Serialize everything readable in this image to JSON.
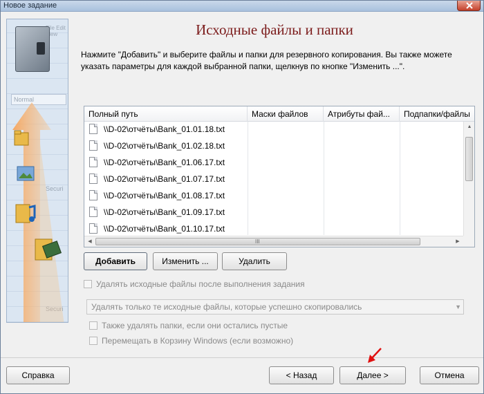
{
  "window": {
    "title": "Новое задание"
  },
  "sidebar": {
    "ghost_menu": "File Edit View",
    "ghost_normal": "Normal",
    "ghost_secur1": "Securi",
    "ghost_secur2": "Securi"
  },
  "page": {
    "heading": "Исходные файлы и папки",
    "description": "Нажмите \"Добавить\" и выберите файлы и папки для резервного копирования. Вы также можете указать параметры для каждой выбранной папки, щелкнув по кнопке \"Изменить ...\"."
  },
  "table": {
    "columns": [
      "Полный путь",
      "Маски файлов",
      "Атрибуты фай...",
      "Подпапки/файлы"
    ],
    "rows": [
      "\\\\D-02\\отчёты\\Bank_01.01.18.txt",
      "\\\\D-02\\отчёты\\Bank_01.02.18.txt",
      "\\\\D-02\\отчёты\\Bank_01.06.17.txt",
      "\\\\D-02\\отчёты\\Bank_01.07.17.txt",
      "\\\\D-02\\отчёты\\Bank_01.08.17.txt",
      "\\\\D-02\\отчёты\\Bank_01.09.17.txt",
      "\\\\D-02\\отчёты\\Bank_01.10.17.txt"
    ],
    "scroll_grip": "III"
  },
  "buttons": {
    "add": "Добавить",
    "edit": "Изменить ...",
    "delete": "Удалить",
    "help": "Справка",
    "back": "< Назад",
    "next": "Далее >",
    "cancel": "Отмена"
  },
  "options": {
    "delete_sources": "Удалять исходные файлы после выполнения задания",
    "delete_mode": "Удалять только те исходные файлы, которые успешно скопировались",
    "delete_empty_folders": "Также удалять папки, если они остались пустые",
    "move_to_recycle": "Перемещать в Корзину Windows (если возможно)"
  },
  "colors": {
    "heading": "#7b1b1b",
    "highlight_arrow": "#f08a30",
    "pointer_arrow": "#e01010"
  }
}
